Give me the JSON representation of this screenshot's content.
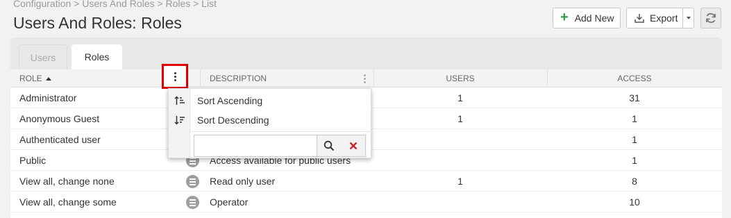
{
  "breadcrumb": "Configuration > Users And Roles > Roles > List",
  "page_title": "Users And Roles: Roles",
  "toolbar": {
    "add_label": "Add New",
    "export_label": "Export"
  },
  "tabs": [
    {
      "label": "Users"
    },
    {
      "label": "Roles"
    }
  ],
  "columns": {
    "role": "ROLE",
    "description": "DESCRIPTION",
    "users": "USERS",
    "access": "ACCESS"
  },
  "rows": [
    {
      "role": "Administrator",
      "description": "",
      "users": "1",
      "access": "31"
    },
    {
      "role": "Anonymous Guest",
      "description": "",
      "users": "1",
      "access": "1"
    },
    {
      "role": "Authenticated user",
      "description": "",
      "users": "",
      "access": "1"
    },
    {
      "role": "Public",
      "description": "Access available for public users",
      "users": "",
      "access": "1"
    },
    {
      "role": "View all, change none",
      "description": "Read only user",
      "users": "1",
      "access": "8"
    },
    {
      "role": "View all, change some",
      "description": "Operator",
      "users": "",
      "access": "10"
    }
  ],
  "column_menu": {
    "sort_ascending": "Sort Ascending",
    "sort_descending": "Sort Descending",
    "filter_value": ""
  },
  "icons": {
    "add": "plus-icon",
    "export": "download-icon",
    "export_menu": "caret-down-icon",
    "refresh": "refresh-icon",
    "column_menu": "kebab-icon",
    "row": "list-icon",
    "sort_asc": "sort-ascending-icon",
    "sort_desc": "sort-descending-icon",
    "search": "search-icon",
    "clear": "close-icon"
  },
  "colors": {
    "accent_green": "#2f9e44",
    "highlight_red": "#e00000",
    "clear_red": "#c62828"
  }
}
